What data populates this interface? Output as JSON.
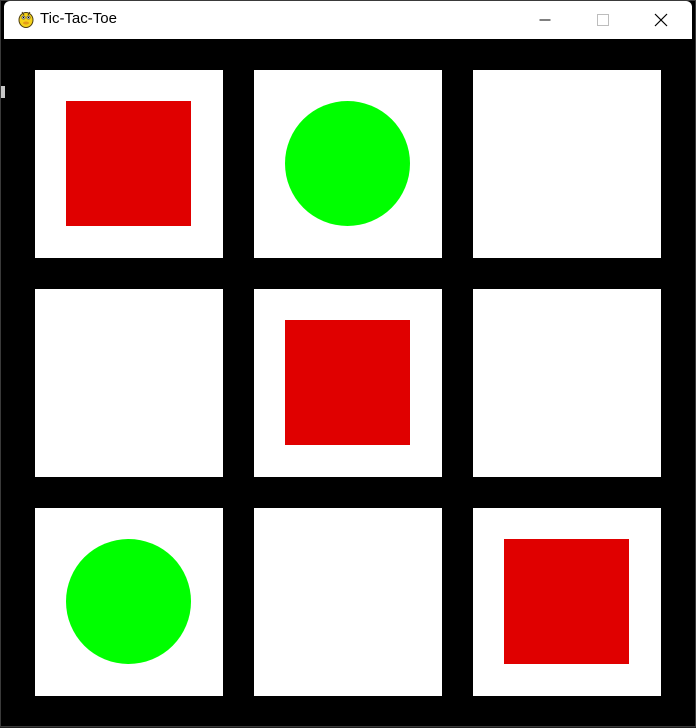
{
  "window": {
    "title": "Tic-Tac-Toe",
    "icon": "pygame-snake-icon"
  },
  "controls": {
    "minimize_icon": "minimize-icon",
    "maximize_icon": "maximize-icon",
    "close_icon": "close-icon"
  },
  "colors": {
    "square_mark": "#e00000",
    "circle_mark": "#00ff00",
    "cell_bg": "#ffffff",
    "board_bg": "#000000"
  },
  "board": {
    "cells": [
      {
        "mark": "square"
      },
      {
        "mark": "circle"
      },
      {
        "mark": ""
      },
      {
        "mark": ""
      },
      {
        "mark": "square"
      },
      {
        "mark": ""
      },
      {
        "mark": "circle"
      },
      {
        "mark": ""
      },
      {
        "mark": "square"
      }
    ]
  }
}
